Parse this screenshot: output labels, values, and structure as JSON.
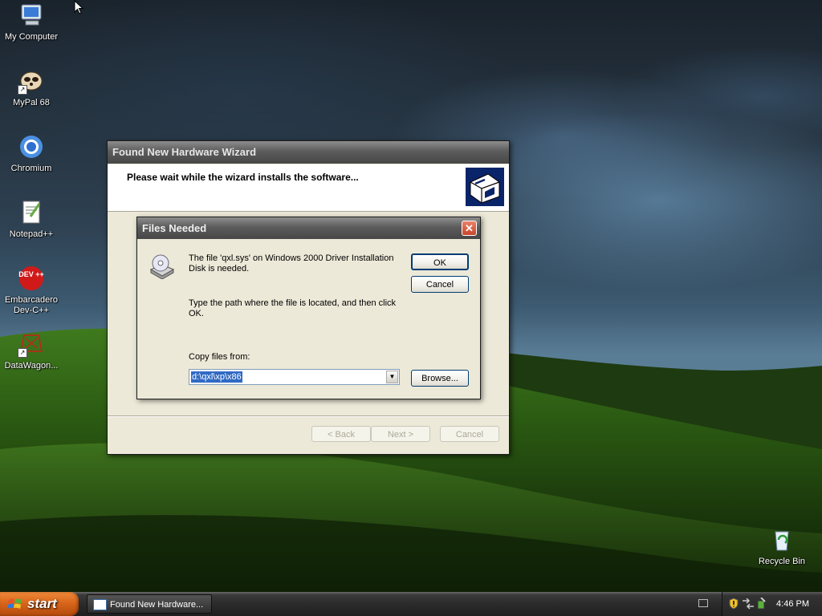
{
  "desktop": {
    "icons": [
      {
        "label": "My Computer",
        "icon": "my-computer-icon"
      },
      {
        "label": "MyPal 68",
        "icon": "mypal-icon"
      },
      {
        "label": "Chromium",
        "icon": "chromium-icon"
      },
      {
        "label": "Notepad++",
        "icon": "notepadpp-icon"
      },
      {
        "label": "Embarcadero Dev-C++",
        "line1": "Embarcadero",
        "line2": "Dev-C++",
        "icon": "devcpp-icon",
        "badge": "DEV ++"
      },
      {
        "label": "DataWagon...",
        "icon": "datawagon-icon"
      },
      {
        "label": "Recycle Bin",
        "icon": "recycle-bin-icon"
      }
    ]
  },
  "wizard": {
    "title": "Found New Hardware Wizard",
    "header": "Please wait while the wizard installs the software...",
    "back_label": "< Back",
    "next_label": "Next >",
    "cancel_label": "Cancel"
  },
  "files_needed": {
    "title": "Files Needed",
    "message": "The file 'qxl.sys' on Windows 2000 Driver Installation Disk is needed.",
    "instruction": "Type the path where the file is located, and then click OK.",
    "copy_label": "Copy files from:",
    "path_value": "d:\\qxl\\xp\\x86",
    "ok_label": "OK",
    "cancel_label": "Cancel",
    "browse_label": "Browse...",
    "close_glyph": "✕"
  },
  "taskbar": {
    "start_label": "start",
    "task_label": "Found New Hardware...",
    "clock": "4:46 PM"
  },
  "colors": {
    "start_orange": "#d9661a",
    "title_gray": "#5c5c5c",
    "selection_blue": "#316ac5"
  }
}
